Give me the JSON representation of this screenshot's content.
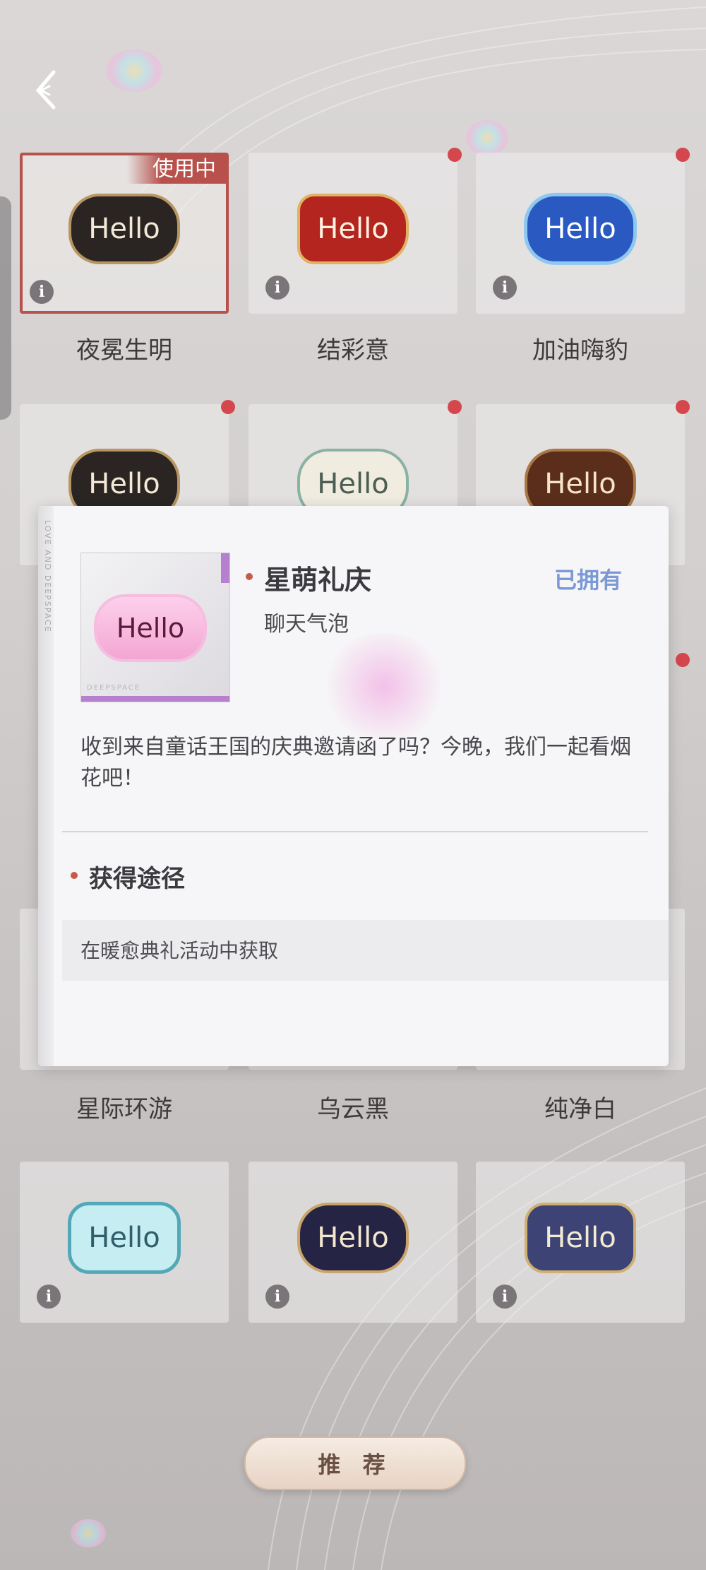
{
  "nav": {
    "back_icon": "chevron-left-icon"
  },
  "badges": {
    "in_use": "使用中"
  },
  "bubble_text": "Hello",
  "grid": [
    {
      "name": "夜冕生明",
      "style": "dark",
      "in_use": true,
      "has_dot": false
    },
    {
      "name": "结彩意",
      "style": "red",
      "in_use": false,
      "has_dot": true
    },
    {
      "name": "加油嗨豹",
      "style": "blue",
      "in_use": false,
      "has_dot": true
    },
    {
      "name": "",
      "style": "dark",
      "in_use": false,
      "has_dot": true
    },
    {
      "name": "",
      "style": "sand",
      "in_use": false,
      "has_dot": true
    },
    {
      "name": "",
      "style": "brown",
      "in_use": false,
      "has_dot": true
    },
    {
      "name": "星际环游",
      "style": "",
      "in_use": false,
      "has_dot": false
    },
    {
      "name": "乌云黑",
      "style": "",
      "in_use": false,
      "has_dot": false
    },
    {
      "name": "纯净白",
      "style": "",
      "in_use": false,
      "has_dot": false
    },
    {
      "name": "",
      "style": "cyan",
      "in_use": false,
      "has_dot": false
    },
    {
      "name": "",
      "style": "navy",
      "in_use": false,
      "has_dot": false
    },
    {
      "name": "",
      "style": "indigo",
      "in_use": false,
      "has_dot": false
    }
  ],
  "modal": {
    "side_text": "LOVE AND DEEPSPACE",
    "thumb_brand": "DEEPSPACE",
    "title": "星萌礼庆",
    "subtitle": "聊天气泡",
    "status": "已拥有",
    "description": "收到来自童话王国的庆典邀请函了吗？今晚，我们一起看烟花吧！",
    "section_title": "获得途径",
    "source": "在暖愈典礼活动中获取"
  },
  "recommend_label": "推 荐",
  "colors": {
    "accent_red": "#b8504b",
    "owned_blue": "#7a99d6",
    "dot_red": "#d4474c"
  }
}
